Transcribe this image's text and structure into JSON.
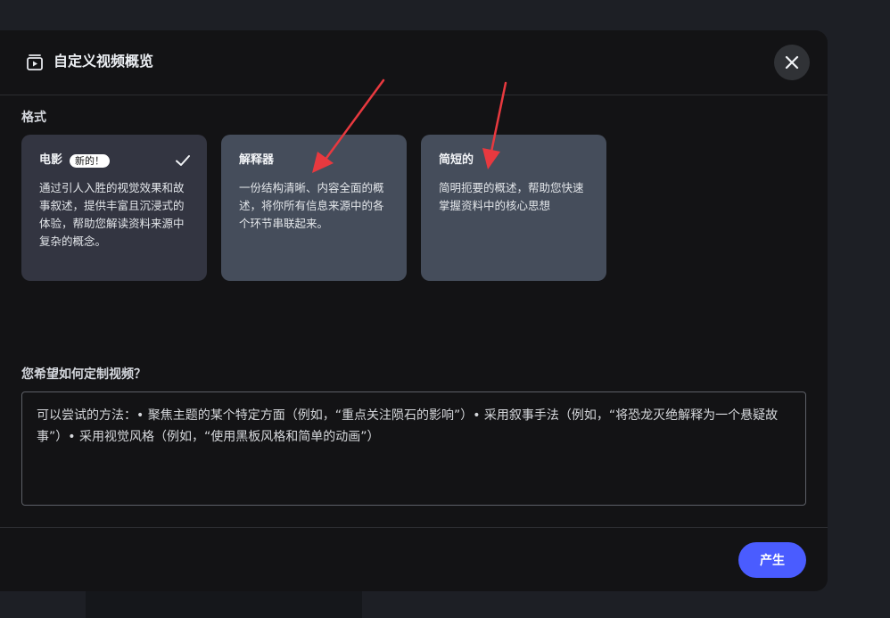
{
  "dialog": {
    "title": "自定义视频概览",
    "title_icon": "video-playlist-icon",
    "close_icon": "close-icon"
  },
  "format": {
    "label": "格式",
    "cards": [
      {
        "title": "电影",
        "badge": "新的！",
        "selected": true,
        "description": "通过引人入胜的视觉效果和故事叙述，提供丰富且沉浸式的体验，帮助您解读资料来源中复杂的概念。"
      },
      {
        "title": "解释器",
        "description": "一份结构清晰、内容全面的概述，将你所有信息来源中的各个环节串联起来。"
      },
      {
        "title": "简短的",
        "description": "简明扼要的概述，帮助您快速掌握资料中的核心思想"
      }
    ]
  },
  "customize": {
    "label": "您希望如何定制视频？",
    "placeholder": "可以尝试的方法：• 聚焦主题的某个特定方面（例如，“重点关注陨石的影响”）• 采用叙事手法（例如，“将恐龙灭绝解释为一个悬疑故事”）• 采用视觉风格（例如，“使用黑板风格和简单的动画”）"
  },
  "footer": {
    "generate_label": "产生"
  },
  "colors": {
    "accent": "#4a5cff",
    "annotation_arrow": "#e8393f"
  }
}
